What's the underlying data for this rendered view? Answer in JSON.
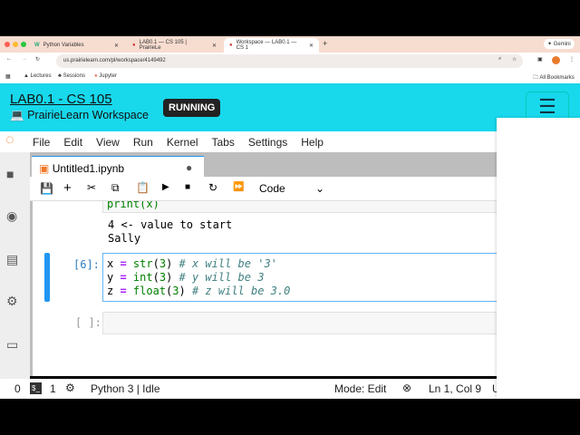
{
  "browser": {
    "tabs": [
      {
        "label": "Python Variables"
      },
      {
        "label": "LAB0.1 — CS 105 | PrairieLe"
      },
      {
        "label": "Workspace — LAB0.1 — CS 1"
      }
    ],
    "gemini": "Gemini",
    "url": "us.prairielearn.com/pl/workspace/4149492",
    "bookmarks": [
      "Lectures",
      "Sessions",
      "Jupyter"
    ],
    "all_bookmarks": "All Bookmarks"
  },
  "header": {
    "title": "LAB0.1 - CS 105",
    "subtitle": "PrairieLearn Workspace",
    "status": "RUNNING"
  },
  "menu": [
    "File",
    "Edit",
    "View",
    "Run",
    "Kernel",
    "Tabs",
    "Settings",
    "Help"
  ],
  "notebook": {
    "tab": "Untitled1.ipynb",
    "cell_type": "Code",
    "prev_code": "print(x)",
    "output": [
      "4 <- value to start",
      "Sally"
    ],
    "cell_prompt": "[6]:",
    "empty_prompt": "[ ]:"
  },
  "status": {
    "left0": "0",
    "terminal": "$_",
    "left1": "1",
    "kernel": "Python 3 | Idle",
    "mode": "Mode: Edit",
    "pos": "Ln 1, Col 9",
    "trunc": "U"
  },
  "colors": {
    "header": "#18d8ec",
    "active_cell": "#2196f3"
  }
}
